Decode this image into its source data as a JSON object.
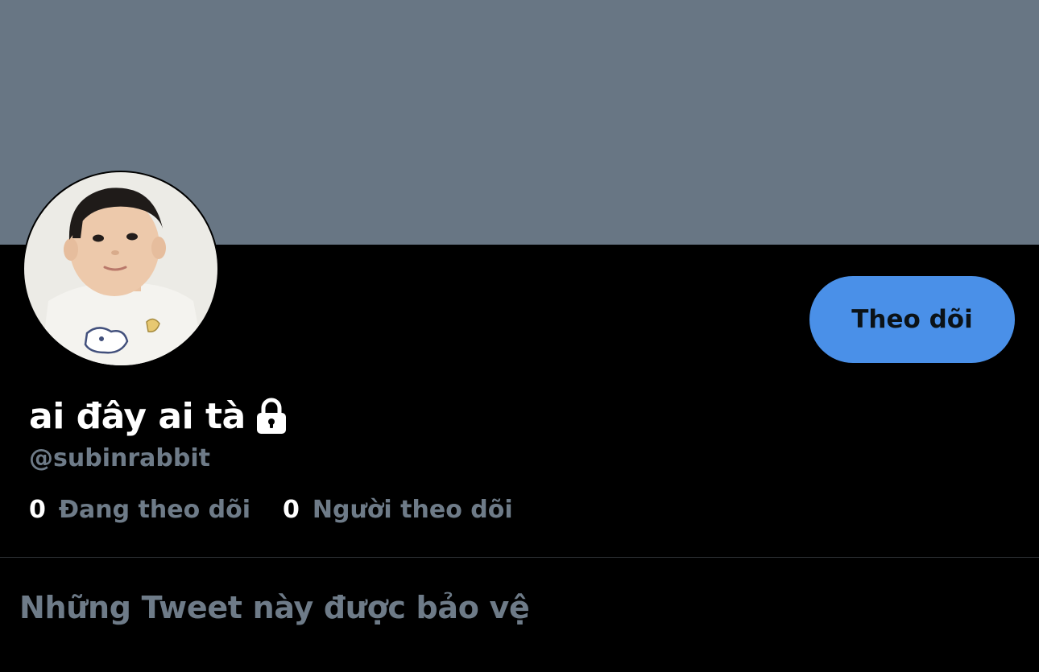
{
  "profile": {
    "display_name": "ai đây ai tà",
    "handle": "@subinrabbit",
    "lock_icon": "lock-icon",
    "avatar_icon": "child-portrait-avatar",
    "follow_label": "Theo dõi",
    "stats": [
      {
        "count": "0",
        "label": "Đang theo dõi"
      },
      {
        "count": "0",
        "label": "Người theo dõi"
      }
    ]
  },
  "timeline": {
    "protected_title": "Những Tweet này được bảo vệ"
  },
  "colors": {
    "banner": "#687684",
    "background": "#000000",
    "accent_button": "#4a90e8",
    "secondary_text": "#6e7b88",
    "primary_text": "#ffffff"
  }
}
